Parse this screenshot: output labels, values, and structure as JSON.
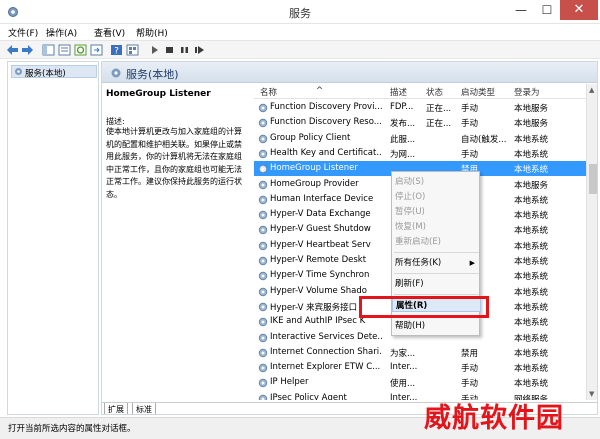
{
  "window": {
    "title": "服务",
    "min": "—",
    "max": "☐",
    "close": "✕"
  },
  "menu": [
    "文件(F)",
    "操作(A)",
    "查看(V)",
    "帮助(H)"
  ],
  "tree": {
    "item": "服务(本地)"
  },
  "main": {
    "header": "服务(本地)",
    "selected_name": "HomeGroup Listener",
    "desc_label": "描述:",
    "desc_text": "使本地计算机更改与加入家庭组的计算机的配置和维护相关联。如果停止或禁用此服务，你的计算机将无法在家庭组中正常工作，且你的家庭组也可能无法正常工作。建议你保持此服务的运行状态。"
  },
  "columns": {
    "name": "名称",
    "desc": "描述",
    "status": "状态",
    "start": "启动类型",
    "logon": "登录为"
  },
  "rows": [
    {
      "name": "Function Discovery Provi...",
      "desc": "FDP...",
      "status": "正在...",
      "start": "手动",
      "logon": "本地服务"
    },
    {
      "name": "Function Discovery Reso...",
      "desc": "发布...",
      "status": "正在...",
      "start": "手动",
      "logon": "本地服务"
    },
    {
      "name": "Group Policy Client",
      "desc": "此服...",
      "status": "",
      "start": "自动(触发...",
      "logon": "本地系统"
    },
    {
      "name": "Health Key and Certificat...",
      "desc": "为网...",
      "status": "",
      "start": "手动",
      "logon": "本地系统"
    },
    {
      "name": "HomeGroup Listener",
      "desc": "",
      "status": "",
      "start": "禁用",
      "logon": "本地系统"
    },
    {
      "name": "HomeGroup Provider",
      "desc": "",
      "status": "",
      "start": "",
      "logon": "本地服务"
    },
    {
      "name": "Human Interface Device",
      "desc": "",
      "status": "",
      "start": "",
      "logon": "本地系统"
    },
    {
      "name": "Hyper-V Data Exchange",
      "desc": "",
      "status": "",
      "start": "",
      "logon": "本地系统"
    },
    {
      "name": "Hyper-V Guest Shutdow",
      "desc": "",
      "status": "",
      "start": "",
      "logon": "本地系统"
    },
    {
      "name": "Hyper-V Heartbeat Serv",
      "desc": "",
      "status": "",
      "start": "",
      "logon": "本地系统"
    },
    {
      "name": "Hyper-V Remote Deskt",
      "desc": "",
      "status": "",
      "start": "",
      "logon": "本地系统"
    },
    {
      "name": "Hyper-V Time Synchron",
      "desc": "",
      "status": "",
      "start": "",
      "logon": "本地系统"
    },
    {
      "name": "Hyper-V Volume Shado",
      "desc": "",
      "status": "",
      "start": "",
      "logon": "本地系统"
    },
    {
      "name": "Hyper-V 来宾服务接口",
      "desc": "",
      "status": "",
      "start": "",
      "logon": "本地系统"
    },
    {
      "name": "IKE and AuthIP IPsec K",
      "desc": "",
      "status": "",
      "start": "",
      "logon": "本地系统"
    },
    {
      "name": "Interactive Services Dete...",
      "desc": "",
      "status": "",
      "start": "",
      "logon": "本地系统"
    },
    {
      "name": "Internet Connection Shari...",
      "desc": "为家...",
      "status": "",
      "start": "禁用",
      "logon": "本地系统"
    },
    {
      "name": "Internet Explorer ETW C...",
      "desc": "Inter...",
      "status": "",
      "start": "手动",
      "logon": "本地系统"
    },
    {
      "name": "IP Helper",
      "desc": "使用...",
      "status": "",
      "start": "手动",
      "logon": "本地系统"
    },
    {
      "name": "IPsec Policy Agent",
      "desc": "Inter...",
      "status": "",
      "start": "手动",
      "logon": "网络服务"
    }
  ],
  "context_menu": {
    "start": "启动(S)",
    "stop": "停止(O)",
    "pause": "暂停(U)",
    "resume": "恢复(M)",
    "restart": "重新启动(E)",
    "all_tasks": "所有任务(K)",
    "refresh": "刷新(F)",
    "properties": "属性(R)",
    "help": "帮助(H)"
  },
  "tabs": [
    "扩展",
    "标准"
  ],
  "status_bar": "打开当前所选内容的属性对话框。",
  "watermark": "威航软件园",
  "colors": {
    "selection": "#3399ff",
    "highlight": "#e3151a",
    "close_button": "#c7504a"
  }
}
